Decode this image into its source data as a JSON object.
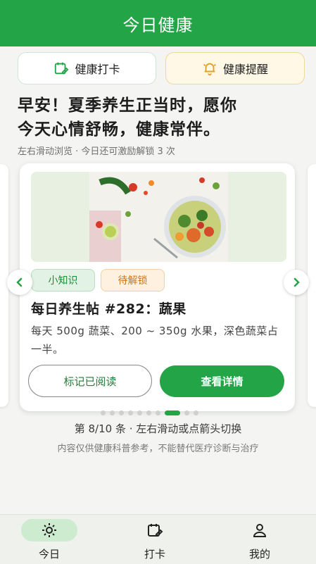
{
  "header": {
    "title": "今日健康"
  },
  "actions": {
    "checkin_label": "健康打卡",
    "remind_label": "健康提醒"
  },
  "greeting": {
    "line1": "早安！夏季养生正当时，愿你",
    "line2": "今天心情舒畅，健康常伴。"
  },
  "hint": "左右滑动浏览 · 今日还可激励解锁 3 次",
  "card": {
    "tag_knowledge": "小知识",
    "tag_locked": "待解锁",
    "title": "每日养生帖 #282：蔬果",
    "body": "每天 500g 蔬菜、200 ~ 350g 水果，深色蔬菜占一半。",
    "mark_read_label": "标记已阅读",
    "view_detail_label": "查看详情",
    "image_icon": "vegetable-salad-photo"
  },
  "carousel": {
    "current": 8,
    "total_dots": 10,
    "pager_text": "第 8/10 条 · 左右滑动或点箭头切换"
  },
  "disclaimer": "内容仅供健康科普参考，不能替代医疗诊断与治疗",
  "tabbar": {
    "items": [
      {
        "label": "今日",
        "icon": "sun-icon",
        "active": true
      },
      {
        "label": "打卡",
        "icon": "calendar-edit-icon",
        "active": false
      },
      {
        "label": "我的",
        "icon": "person-icon",
        "active": false
      }
    ]
  },
  "colors": {
    "primary": "#22a447",
    "tag_knowledge_bg": "#e2f2e4",
    "tag_locked_bg": "#fff1e0",
    "remind_bg": "#fff8e6"
  }
}
